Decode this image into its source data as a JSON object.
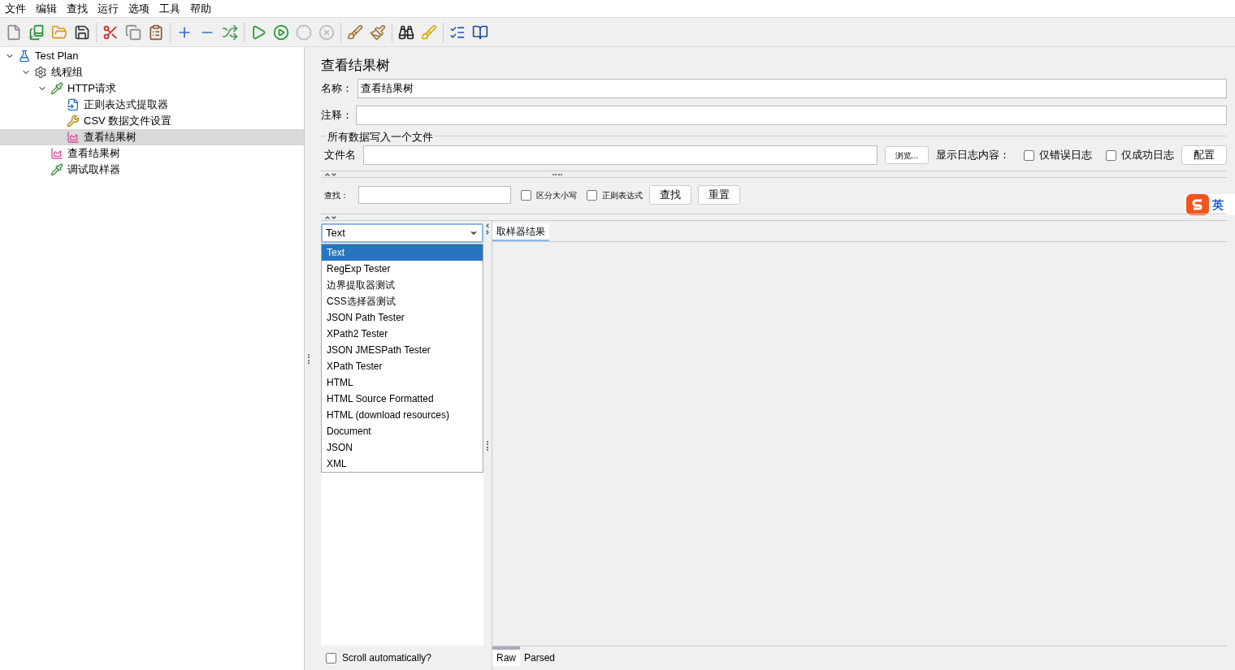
{
  "menu": [
    "文件",
    "编辑",
    "查找",
    "运行",
    "选项",
    "工具",
    "帮助"
  ],
  "tree": [
    {
      "label": "Test Plan",
      "kind": "plan",
      "expanded": true,
      "selected": false,
      "children": [
        {
          "label": "线程组",
          "kind": "threads",
          "expanded": true,
          "selected": false,
          "children": [
            {
              "label": "HTTP请求",
              "kind": "sampler",
              "expanded": true,
              "selected": false,
              "children": [
                {
                  "label": "正则表达式提取器",
                  "kind": "extractor",
                  "selected": false
                },
                {
                  "label": "CSV 数据文件设置",
                  "kind": "config",
                  "selected": false
                },
                {
                  "label": "查看结果树",
                  "kind": "listener",
                  "selected": true
                }
              ]
            },
            {
              "label": "查看结果树",
              "kind": "listener",
              "selected": false
            },
            {
              "label": "调试取样器",
              "kind": "sampler",
              "selected": false
            }
          ]
        }
      ]
    }
  ],
  "panel": {
    "title": "查看结果树",
    "name_label": "名称：",
    "name_value": "查看结果树",
    "comment_label": "注释：",
    "file_group": {
      "legend": "所有数据写入一个文件",
      "file_label": "文件名",
      "browse_button": "浏览...",
      "log_label": "显示日志内容：",
      "checkboxes": [
        {
          "label": "仅错误日志",
          "checked": false
        },
        {
          "label": "仅成功日志",
          "checked": false
        }
      ],
      "config_button": "配置"
    },
    "search": {
      "label": "查找：",
      "checkboxes": [
        {
          "label": "区分大小写",
          "checked": false
        },
        {
          "label": "正则表达式",
          "checked": false
        }
      ],
      "buttons": [
        "查找",
        "重置"
      ]
    },
    "renderer": {
      "value": "Text",
      "options": [
        {
          "label": "Text",
          "selected": true
        },
        {
          "label": "RegExp Tester",
          "selected": false
        },
        {
          "label": "边界提取器测试",
          "selected": false
        },
        {
          "label": "CSS选择器测试",
          "selected": false
        },
        {
          "label": "JSON Path Tester",
          "selected": false
        },
        {
          "label": "XPath2 Tester",
          "selected": false
        },
        {
          "label": "JSON JMESPath Tester",
          "selected": false
        },
        {
          "label": "XPath Tester",
          "selected": false
        },
        {
          "label": "HTML",
          "selected": false
        },
        {
          "label": "HTML Source Formatted",
          "selected": false
        },
        {
          "label": "HTML (download resources)",
          "selected": false
        },
        {
          "label": "Document",
          "selected": false
        },
        {
          "label": "JSON",
          "selected": false
        },
        {
          "label": "XML",
          "selected": false
        }
      ]
    },
    "result_tabs": [
      {
        "label": "取样器结果",
        "selected": true
      }
    ],
    "scroll_checkbox": {
      "label": "Scroll automatically?",
      "checked": false
    },
    "bottom_tabs": [
      {
        "label": "Raw",
        "selected": true
      },
      {
        "label": "Parsed",
        "selected": false
      }
    ]
  },
  "ime": {
    "label": "英"
  }
}
